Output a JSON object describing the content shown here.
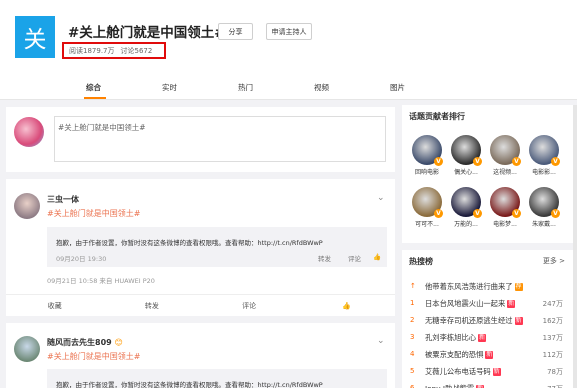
{
  "header": {
    "logo_char": "关",
    "title": "#关上舱门就是中国领土#",
    "share_label": "分享",
    "host_label": "申请主持人",
    "reads": "阅读1879.7万",
    "comments": "讨论5672",
    "highlight_color": "#e00b0b"
  },
  "tabs": [
    "综合",
    "实时",
    "热门",
    "视频",
    "图片"
  ],
  "composer": {
    "placeholder": "#关上舱门就是中国领土#"
  },
  "posts": [
    {
      "user": "三虫一体",
      "hashtag": "#关上舱门就是中国领土#",
      "repost_text": "抱歉，由于作者设置，你暂时没有这条微博的查看权限哦。查看帮助：http://t.cn/RfdBWwP",
      "repost_time": "09月20日 19:30",
      "repost_actions": [
        "转发",
        "评论"
      ],
      "meta": "09月21日 10:58  来自 HUAWEI P20",
      "actions": [
        "收藏",
        "转发",
        "评论"
      ]
    },
    {
      "user": "随风而去先生809",
      "hashtag": "#关上舱门就是中国领土#",
      "repost_text": "抱歉，由于作者设置，你暂时没有这条微博的查看权限哦。查看帮助：http://t.cn/RfdBWwP"
    }
  ],
  "sidebar": {
    "contrib_title": "话题贡献者排行",
    "contributors": [
      {
        "name": "回响电影",
        "color": "#3a4a6a"
      },
      {
        "name": "偶关心...",
        "color": "#2b2b2b"
      },
      {
        "name": "这视频...",
        "color": "#7a6a5a"
      },
      {
        "name": "电影影...",
        "color": "#4a5a7a"
      },
      {
        "name": "可可不...",
        "color": "#8a6a3a"
      },
      {
        "name": "万能的...",
        "color": "#1a1a3a"
      },
      {
        "name": "电影梦...",
        "color": "#7a1a1a"
      },
      {
        "name": "朱家戴...",
        "color": "#3a3a3a"
      }
    ],
    "hot_title": "热搜榜",
    "hot_more": "更多 >",
    "hot_list": [
      {
        "rank": "",
        "text": "他带着东风浩荡进行曲来了",
        "num": "",
        "badge": "荐",
        "badge_color": "#ff9406"
      },
      {
        "rank": "1",
        "text": "日本台风地震火山一起来",
        "num": "247万",
        "badge": "新",
        "badge_color": "#ff3852"
      },
      {
        "rank": "2",
        "text": "无糖幸存司机还原逃生经过",
        "num": "162万",
        "badge": "新",
        "badge_color": "#ff3852"
      },
      {
        "rank": "3",
        "text": "孔刘李栋旭比心",
        "num": "137万",
        "badge": "新",
        "badge_color": "#ff3852"
      },
      {
        "rank": "4",
        "text": "被粟京支配的恐惧",
        "num": "112万",
        "badge": "新",
        "badge_color": "#ff3852"
      },
      {
        "rank": "5",
        "text": "艾薇儿公布电话号码",
        "num": "78万",
        "badge": "新",
        "badge_color": "#ff3852"
      },
      {
        "rank": "6",
        "text": "Jony J助战熊霸",
        "num": "77万",
        "badge": "新",
        "badge_color": "#ff3852"
      }
    ]
  }
}
